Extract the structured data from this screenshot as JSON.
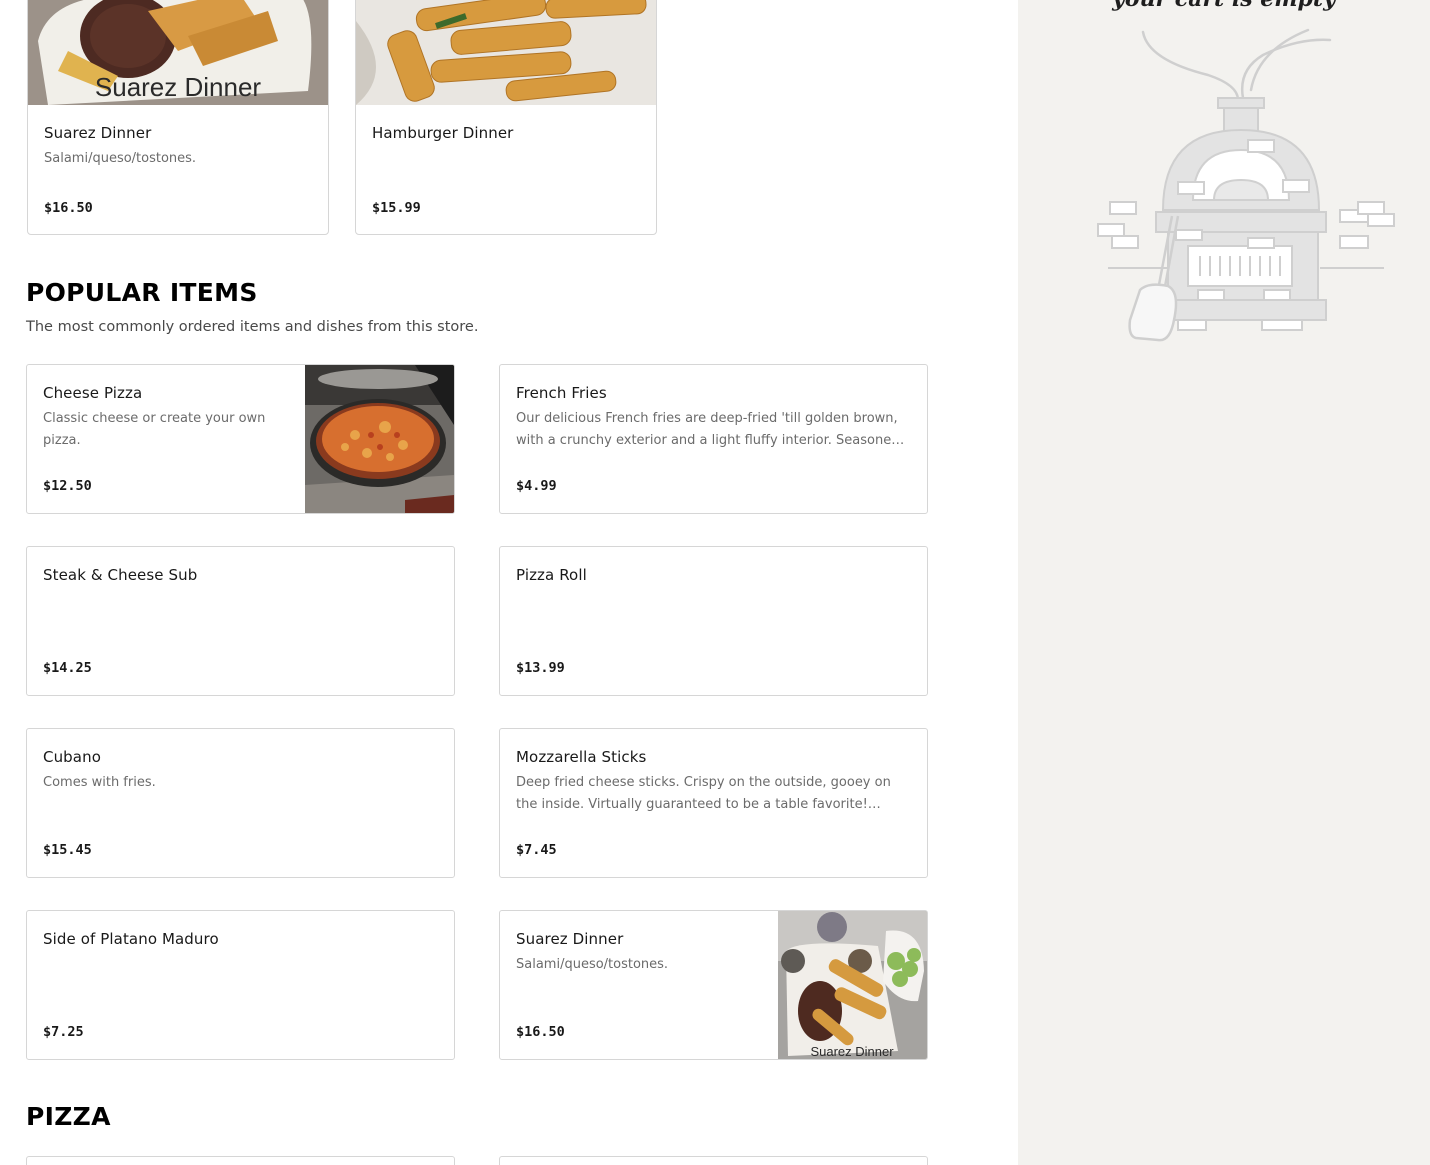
{
  "featured": [
    {
      "name": "Suarez Dinner",
      "description": "Salami/queso/tostones.",
      "price": "$16.50",
      "image_caption": "Suarez Dinner"
    },
    {
      "name": "Hamburger Dinner",
      "description": "",
      "price": "$15.99"
    }
  ],
  "popular": {
    "title": "POPULAR ITEMS",
    "subtitle": "The most commonly ordered items and dishes from this store.",
    "items": [
      {
        "name": "Cheese Pizza",
        "description": "Classic cheese or create your own pizza.",
        "price": "$12.50"
      },
      {
        "name": "French Fries",
        "description": "Our delicious French fries are deep-fried 'till golden brown, with a crunchy exterior and a light fluffy interior. Seasoned to perfection.",
        "price": "$4.99"
      },
      {
        "name": "Steak & Cheese Sub",
        "description": "",
        "price": "$14.25"
      },
      {
        "name": "Pizza Roll",
        "description": "",
        "price": "$13.99"
      },
      {
        "name": "Cubano",
        "description": "Comes with fries.",
        "price": "$15.45"
      },
      {
        "name": "Mozzarella Sticks",
        "description": "Deep fried cheese sticks. Crispy on the outside, gooey on the inside. Virtually guaranteed to be a table favorite! Served with marinara.",
        "price": "$7.45"
      },
      {
        "name": "Side of Platano Maduro",
        "description": "",
        "price": "$7.25"
      },
      {
        "name": "Suarez Dinner",
        "description": "Salami/queso/tostones.",
        "price": "$16.50",
        "image_caption": "Suarez Dinner"
      }
    ]
  },
  "pizza_section": {
    "title": "PIZZA"
  },
  "cart": {
    "empty_text": "your cart is empty"
  }
}
